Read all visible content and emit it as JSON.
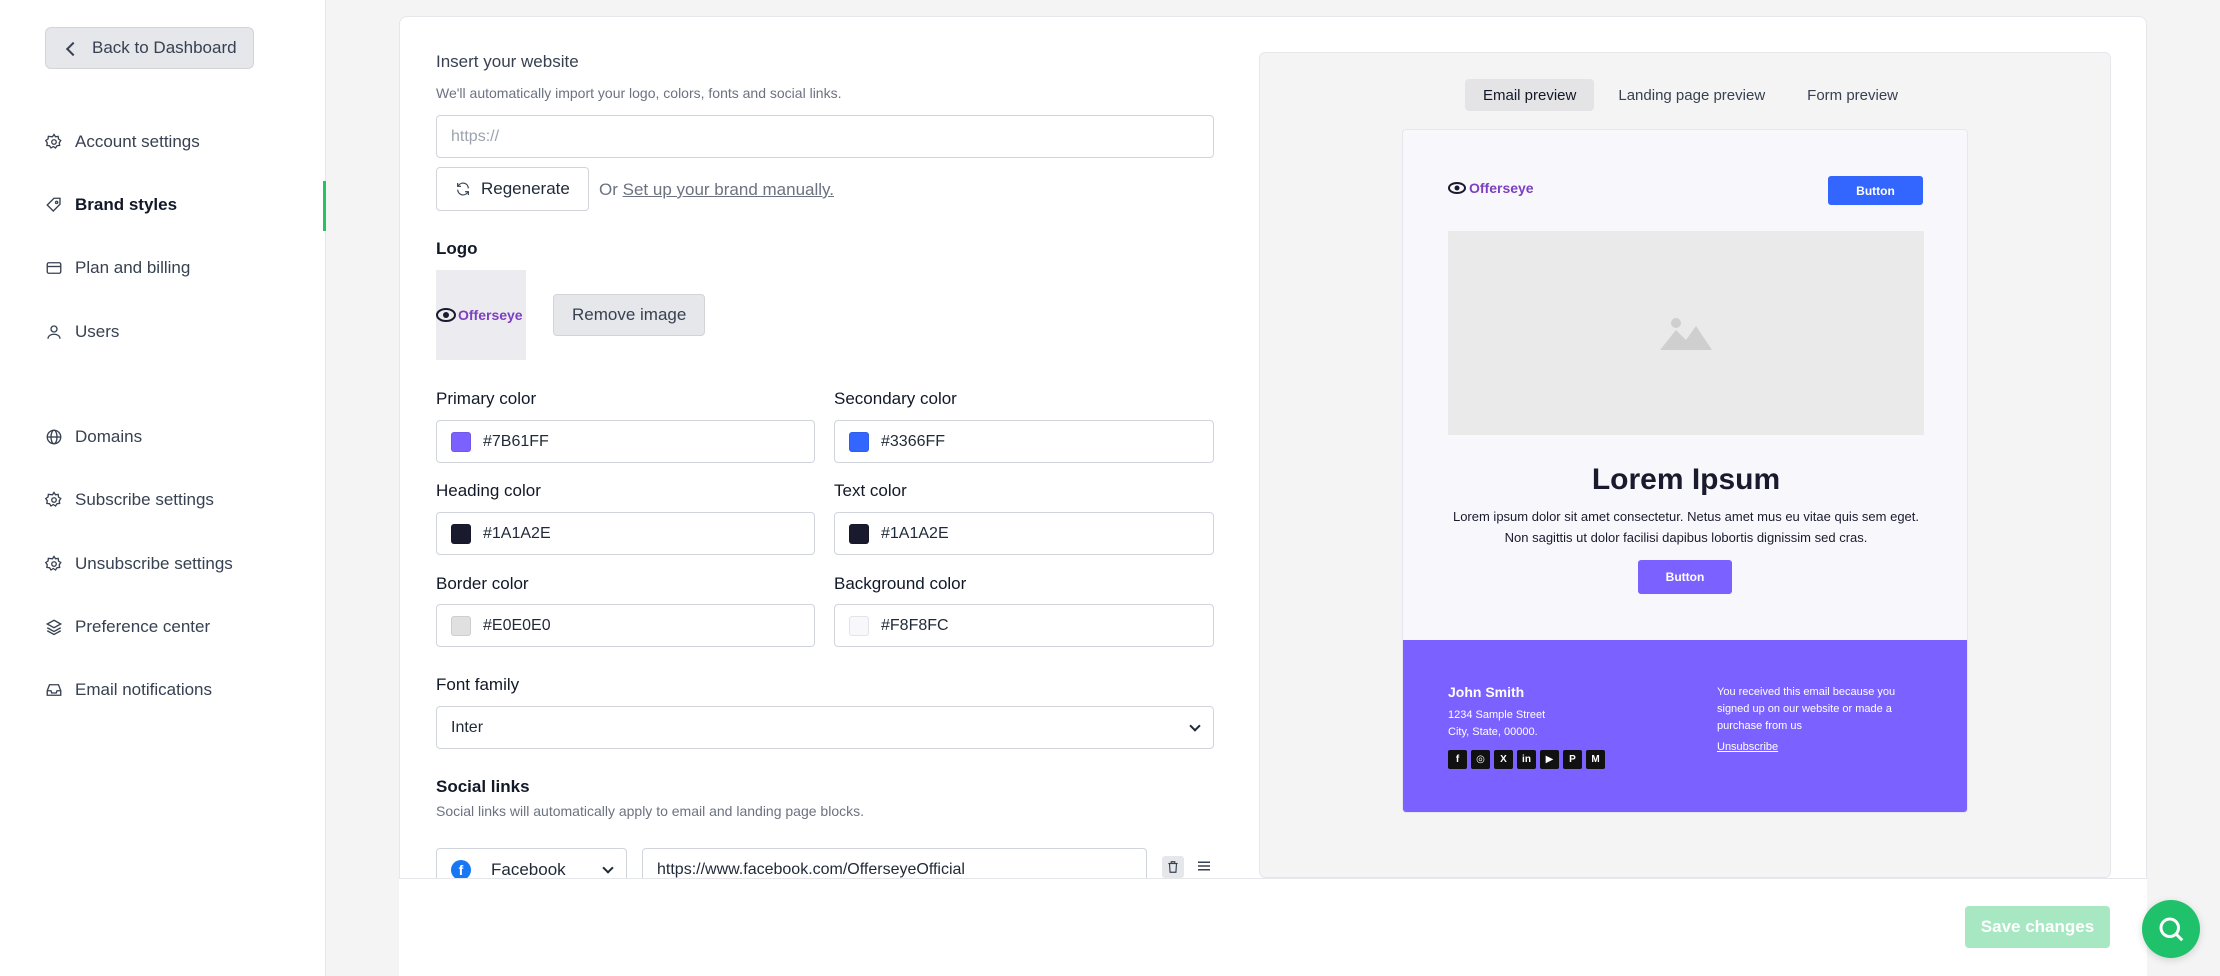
{
  "sidebar": {
    "back_label": "Back to Dashboard",
    "items": [
      {
        "label": "Account settings",
        "icon": "gear-icon"
      },
      {
        "label": "Brand styles",
        "icon": "tag-icon",
        "active": true
      },
      {
        "label": "Plan and billing",
        "icon": "credit-card-icon"
      },
      {
        "label": "Users",
        "icon": "user-icon"
      },
      {
        "label": "Domains",
        "icon": "globe-icon"
      },
      {
        "label": "Subscribe settings",
        "icon": "gear-icon"
      },
      {
        "label": "Unsubscribe settings",
        "icon": "gear-icon"
      },
      {
        "label": "Preference center",
        "icon": "layers-icon"
      },
      {
        "label": "Email notifications",
        "icon": "inbox-icon"
      }
    ],
    "accent_color": "#22c55e"
  },
  "website": {
    "title": "Insert your website",
    "helper": "We'll automatically import your logo, colors, fonts and social links.",
    "placeholder": "https://",
    "regenerate_label": "Regenerate",
    "or_text": "Or",
    "manual_link": "Set up your brand manually."
  },
  "logo": {
    "title": "Logo",
    "remove_label": "Remove image",
    "brand_text": "Offerseye"
  },
  "colors": {
    "primary": {
      "label": "Primary color",
      "value": "#7B61FF",
      "swatch": "#7B61FF"
    },
    "secondary": {
      "label": "Secondary color",
      "value": "#3366FF",
      "swatch": "#3366FF"
    },
    "heading": {
      "label": "Heading color",
      "value": "#1A1A2E",
      "swatch": "#1A1A2E"
    },
    "text": {
      "label": "Text color",
      "value": "#1A1A2E",
      "swatch": "#1A1A2E"
    },
    "border": {
      "label": "Border color",
      "value": "#E0E0E0",
      "swatch": "#E0E0E0"
    },
    "background": {
      "label": "Background color",
      "value": "#F8F8FC",
      "swatch": "#F8F8FC"
    }
  },
  "font": {
    "label": "Font family",
    "value": "Inter"
  },
  "social": {
    "title": "Social links",
    "helper": "Social links will automatically apply to email and landing page blocks.",
    "rows": [
      {
        "platform": "Facebook",
        "url": "https://www.facebook.com/OfferseyeOfficial"
      }
    ]
  },
  "preview": {
    "tabs": [
      "Email preview",
      "Landing page preview",
      "Form preview"
    ],
    "active_tab": 0,
    "email": {
      "brand": "Offerseye",
      "header_button": "Button",
      "title": "Lorem Ipsum",
      "body": "Lorem ipsum dolor sit amet consectetur. Netus amet mus eu vitae quis sem eget. Non sagittis ut dolor facilisi dapibus lobortis dignissim sed cras.",
      "cta_button": "Button",
      "footer": {
        "name": "John Smith",
        "address1": "1234 Sample Street",
        "address2": "City, State, 00000.",
        "notice": "You received this email because you signed up on our website or made a purchase from us",
        "unsubscribe": "Unsubscribe",
        "social_icons": [
          "facebook-icon",
          "instagram-icon",
          "x-icon",
          "linkedin-icon",
          "youtube-icon",
          "pinterest-icon",
          "medium-icon"
        ]
      }
    }
  },
  "footer_bar": {
    "save_label": "Save changes"
  }
}
